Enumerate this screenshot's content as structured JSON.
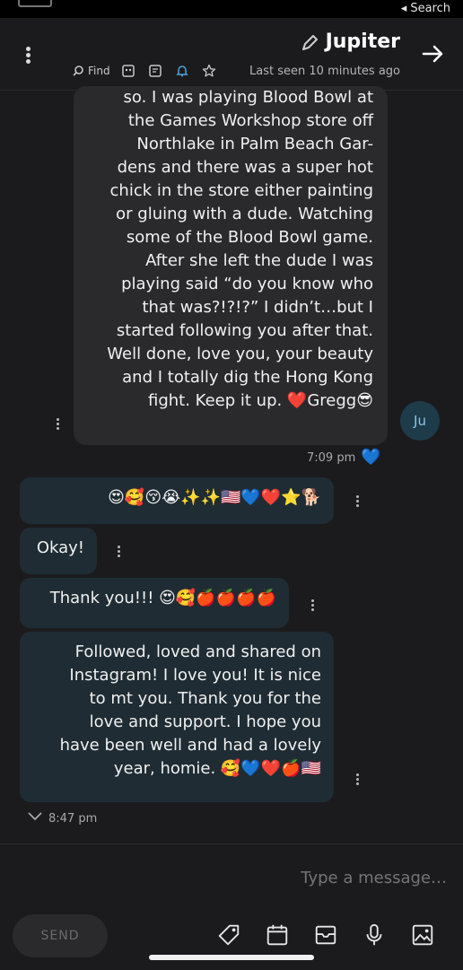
{
  "status_bar": {
    "back_label": "Search",
    "back_arrow": "◂"
  },
  "header": {
    "title": "Jupiter",
    "last_seen": "Last seen 10 minutes ago",
    "find_label": "Find"
  },
  "messages": {
    "incoming": {
      "lines": [
        "so. I was playing Blood Bowl at",
        "the Games Workshop store off",
        "Northlake in Palm Beach Gar-",
        "dens and there was a super hot",
        "chick in the store either painting",
        "or gluing with a dude. Watching",
        "some of the Blood Bowl game.",
        "After she left the dude I was",
        "playing said “do you know who",
        "that was?!?!?” I didn’t…but I",
        "started following you after that.",
        "Well done, love you, your beauty",
        "and I totally dig the Hong Kong",
        "fight. Keep it up. ❤️Gregg😎"
      ],
      "avatar": "Ju",
      "time": "7:09 pm",
      "reaction": "💙"
    },
    "outgoing": [
      {
        "text": "😍🥰😚😭✨✨🇺🇸💙❤️⭐🐕"
      },
      {
        "text": "Okay!"
      },
      {
        "text": "Thank you!!! 😍🥰🍎🍎🍎🍎"
      },
      {
        "lines": [
          "Followed, loved and shared on",
          "Instagram! I love you! It is nice",
          "to mt you. Thank you for the",
          "love and support. I hope you",
          "have been well and had a lovely",
          "year, homie. 🥰💙❤️🍎🇺🇸"
        ]
      }
    ],
    "outgoing_time": "8:47 pm"
  },
  "composer": {
    "placeholder": "Type a message…",
    "send_label": "SEND"
  },
  "colors": {
    "background": "#1b1b1d",
    "incoming_bubble": "#2a2a2c",
    "outgoing_bubble": "#1f2c33",
    "accent_blue": "#4aa3df"
  }
}
